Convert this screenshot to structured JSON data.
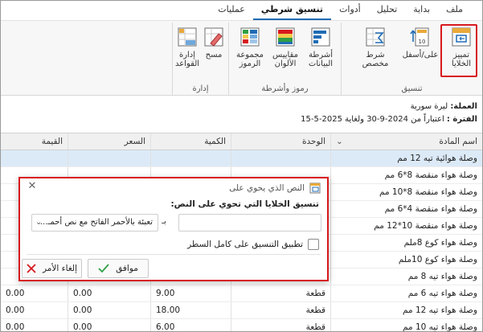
{
  "tabs": [
    "ملف",
    "بداية",
    "تحليل",
    "أدوات",
    "تنسيق شرطي",
    "عمليات"
  ],
  "active_tab": "تنسيق شرطي",
  "ribbon": {
    "groups": {
      "format": "تنسيق",
      "icons": "رموز وأشرطة",
      "manage": "إدارة"
    },
    "buttons": {
      "highlight_cells": "تمييز\nالخلايا",
      "top_bottom": "على/أسفل",
      "custom_condition": "شرط\nمخصص",
      "data_bars": "أشرطة\nالبيانات",
      "color_scales": "مقاييس\nالألوان",
      "icon_sets": "مجموعة\nالرموز",
      "clear": "مسح",
      "manage_rules": "إدارة\nالقواعد"
    }
  },
  "info": {
    "currency_label": "العملة:",
    "currency_value": "ليرة سورية",
    "period_label": "الفترة :",
    "period_value": "اعتباراً من 2024-9-30 ولغاية 2025-5-15"
  },
  "grid": {
    "headers": {
      "name": "اسم المادة",
      "unit": "الوحدة",
      "qty": "الكمية",
      "price": "السعر",
      "value": "القيمة"
    },
    "rows": [
      {
        "name": "وصلة هوائية تيه 12 مم",
        "unit": "",
        "qty": "",
        "price": "",
        "value": ""
      },
      {
        "name": "وصلة هواء منقصة 8*6 مم",
        "unit": "",
        "qty": "",
        "price": "",
        "value": ""
      },
      {
        "name": "وصلة هواء منقصة 8*10 مم",
        "unit": "",
        "qty": "",
        "price": "",
        "value": ""
      },
      {
        "name": "وصلة هواء منقصة 4*6 مم",
        "unit": "",
        "qty": "",
        "price": "",
        "value": ""
      },
      {
        "name": "وصلة هواء منقصة 10*12 مم",
        "unit": "",
        "qty": "",
        "price": "",
        "value": ""
      },
      {
        "name": "وصلة هواء كوع 8ملم",
        "unit": "",
        "qty": "",
        "price": "",
        "value": ""
      },
      {
        "name": "وصلة هواء كوع 10ملم",
        "unit": "",
        "qty": "",
        "price": "",
        "value": ""
      },
      {
        "name": "وصلة هواء تيه 8 مم",
        "unit": "",
        "qty": "",
        "price": "",
        "value": ""
      },
      {
        "name": "وصلة هواء تيه 6 مم",
        "unit": "قطعة",
        "qty": "9.00",
        "price": "0.00",
        "value": "0.00"
      },
      {
        "name": "وصلة هواء تيه 12 مم",
        "unit": "قطعة",
        "qty": "18.00",
        "price": "0.00",
        "value": "0.00"
      },
      {
        "name": "وصلة هواء تيه 10 مم",
        "unit": "قطعة",
        "qty": "6.00",
        "price": "0.00",
        "value": "0.00"
      }
    ]
  },
  "dialog": {
    "title": "النص الذي يحوي على",
    "heading": "تنسيق الخلايا التي تحوي على النص:",
    "with_label": "بـ",
    "format_option": "تعبئة بالأحمر الفاتح مع نص أحمـ...",
    "input_value": "",
    "apply_row_label": "تطبيق التنسيق على كامل السطر",
    "ok_label": "موافق",
    "cancel_label": "إلغاء الأمر"
  },
  "colors": {
    "accent": "#1f6cb5",
    "highlight": "#d7191e",
    "ok_check": "#2e9e44",
    "cancel_x": "#d7191e"
  }
}
